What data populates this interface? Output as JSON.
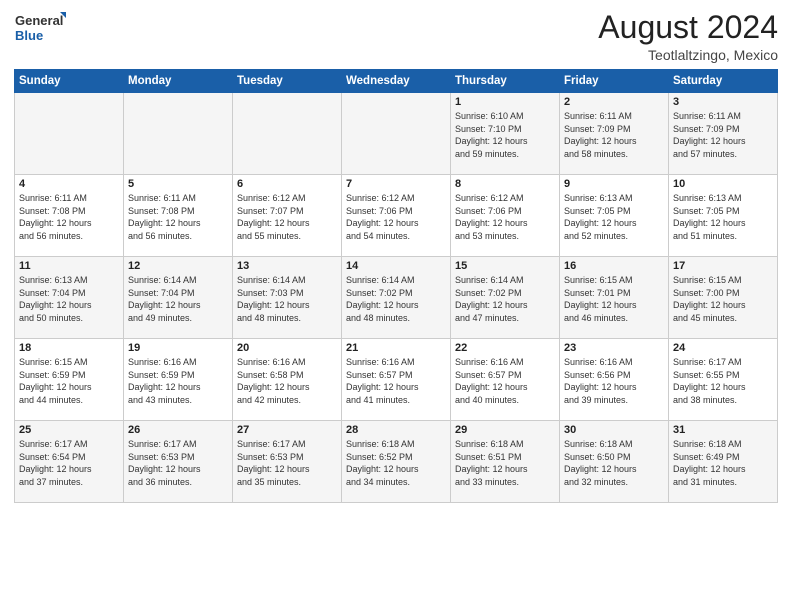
{
  "logo": {
    "line1": "General",
    "line2": "Blue"
  },
  "title": "August 2024",
  "location": "Teotlaltzingo, Mexico",
  "days_header": [
    "Sunday",
    "Monday",
    "Tuesday",
    "Wednesday",
    "Thursday",
    "Friday",
    "Saturday"
  ],
  "weeks": [
    [
      {
        "day": "",
        "info": ""
      },
      {
        "day": "",
        "info": ""
      },
      {
        "day": "",
        "info": ""
      },
      {
        "day": "",
        "info": ""
      },
      {
        "day": "1",
        "info": "Sunrise: 6:10 AM\nSunset: 7:10 PM\nDaylight: 12 hours\nand 59 minutes."
      },
      {
        "day": "2",
        "info": "Sunrise: 6:11 AM\nSunset: 7:09 PM\nDaylight: 12 hours\nand 58 minutes."
      },
      {
        "day": "3",
        "info": "Sunrise: 6:11 AM\nSunset: 7:09 PM\nDaylight: 12 hours\nand 57 minutes."
      }
    ],
    [
      {
        "day": "4",
        "info": "Sunrise: 6:11 AM\nSunset: 7:08 PM\nDaylight: 12 hours\nand 56 minutes."
      },
      {
        "day": "5",
        "info": "Sunrise: 6:11 AM\nSunset: 7:08 PM\nDaylight: 12 hours\nand 56 minutes."
      },
      {
        "day": "6",
        "info": "Sunrise: 6:12 AM\nSunset: 7:07 PM\nDaylight: 12 hours\nand 55 minutes."
      },
      {
        "day": "7",
        "info": "Sunrise: 6:12 AM\nSunset: 7:06 PM\nDaylight: 12 hours\nand 54 minutes."
      },
      {
        "day": "8",
        "info": "Sunrise: 6:12 AM\nSunset: 7:06 PM\nDaylight: 12 hours\nand 53 minutes."
      },
      {
        "day": "9",
        "info": "Sunrise: 6:13 AM\nSunset: 7:05 PM\nDaylight: 12 hours\nand 52 minutes."
      },
      {
        "day": "10",
        "info": "Sunrise: 6:13 AM\nSunset: 7:05 PM\nDaylight: 12 hours\nand 51 minutes."
      }
    ],
    [
      {
        "day": "11",
        "info": "Sunrise: 6:13 AM\nSunset: 7:04 PM\nDaylight: 12 hours\nand 50 minutes."
      },
      {
        "day": "12",
        "info": "Sunrise: 6:14 AM\nSunset: 7:04 PM\nDaylight: 12 hours\nand 49 minutes."
      },
      {
        "day": "13",
        "info": "Sunrise: 6:14 AM\nSunset: 7:03 PM\nDaylight: 12 hours\nand 48 minutes."
      },
      {
        "day": "14",
        "info": "Sunrise: 6:14 AM\nSunset: 7:02 PM\nDaylight: 12 hours\nand 48 minutes."
      },
      {
        "day": "15",
        "info": "Sunrise: 6:14 AM\nSunset: 7:02 PM\nDaylight: 12 hours\nand 47 minutes."
      },
      {
        "day": "16",
        "info": "Sunrise: 6:15 AM\nSunset: 7:01 PM\nDaylight: 12 hours\nand 46 minutes."
      },
      {
        "day": "17",
        "info": "Sunrise: 6:15 AM\nSunset: 7:00 PM\nDaylight: 12 hours\nand 45 minutes."
      }
    ],
    [
      {
        "day": "18",
        "info": "Sunrise: 6:15 AM\nSunset: 6:59 PM\nDaylight: 12 hours\nand 44 minutes."
      },
      {
        "day": "19",
        "info": "Sunrise: 6:16 AM\nSunset: 6:59 PM\nDaylight: 12 hours\nand 43 minutes."
      },
      {
        "day": "20",
        "info": "Sunrise: 6:16 AM\nSunset: 6:58 PM\nDaylight: 12 hours\nand 42 minutes."
      },
      {
        "day": "21",
        "info": "Sunrise: 6:16 AM\nSunset: 6:57 PM\nDaylight: 12 hours\nand 41 minutes."
      },
      {
        "day": "22",
        "info": "Sunrise: 6:16 AM\nSunset: 6:57 PM\nDaylight: 12 hours\nand 40 minutes."
      },
      {
        "day": "23",
        "info": "Sunrise: 6:16 AM\nSunset: 6:56 PM\nDaylight: 12 hours\nand 39 minutes."
      },
      {
        "day": "24",
        "info": "Sunrise: 6:17 AM\nSunset: 6:55 PM\nDaylight: 12 hours\nand 38 minutes."
      }
    ],
    [
      {
        "day": "25",
        "info": "Sunrise: 6:17 AM\nSunset: 6:54 PM\nDaylight: 12 hours\nand 37 minutes."
      },
      {
        "day": "26",
        "info": "Sunrise: 6:17 AM\nSunset: 6:53 PM\nDaylight: 12 hours\nand 36 minutes."
      },
      {
        "day": "27",
        "info": "Sunrise: 6:17 AM\nSunset: 6:53 PM\nDaylight: 12 hours\nand 35 minutes."
      },
      {
        "day": "28",
        "info": "Sunrise: 6:18 AM\nSunset: 6:52 PM\nDaylight: 12 hours\nand 34 minutes."
      },
      {
        "day": "29",
        "info": "Sunrise: 6:18 AM\nSunset: 6:51 PM\nDaylight: 12 hours\nand 33 minutes."
      },
      {
        "day": "30",
        "info": "Sunrise: 6:18 AM\nSunset: 6:50 PM\nDaylight: 12 hours\nand 32 minutes."
      },
      {
        "day": "31",
        "info": "Sunrise: 6:18 AM\nSunset: 6:49 PM\nDaylight: 12 hours\nand 31 minutes."
      }
    ]
  ]
}
